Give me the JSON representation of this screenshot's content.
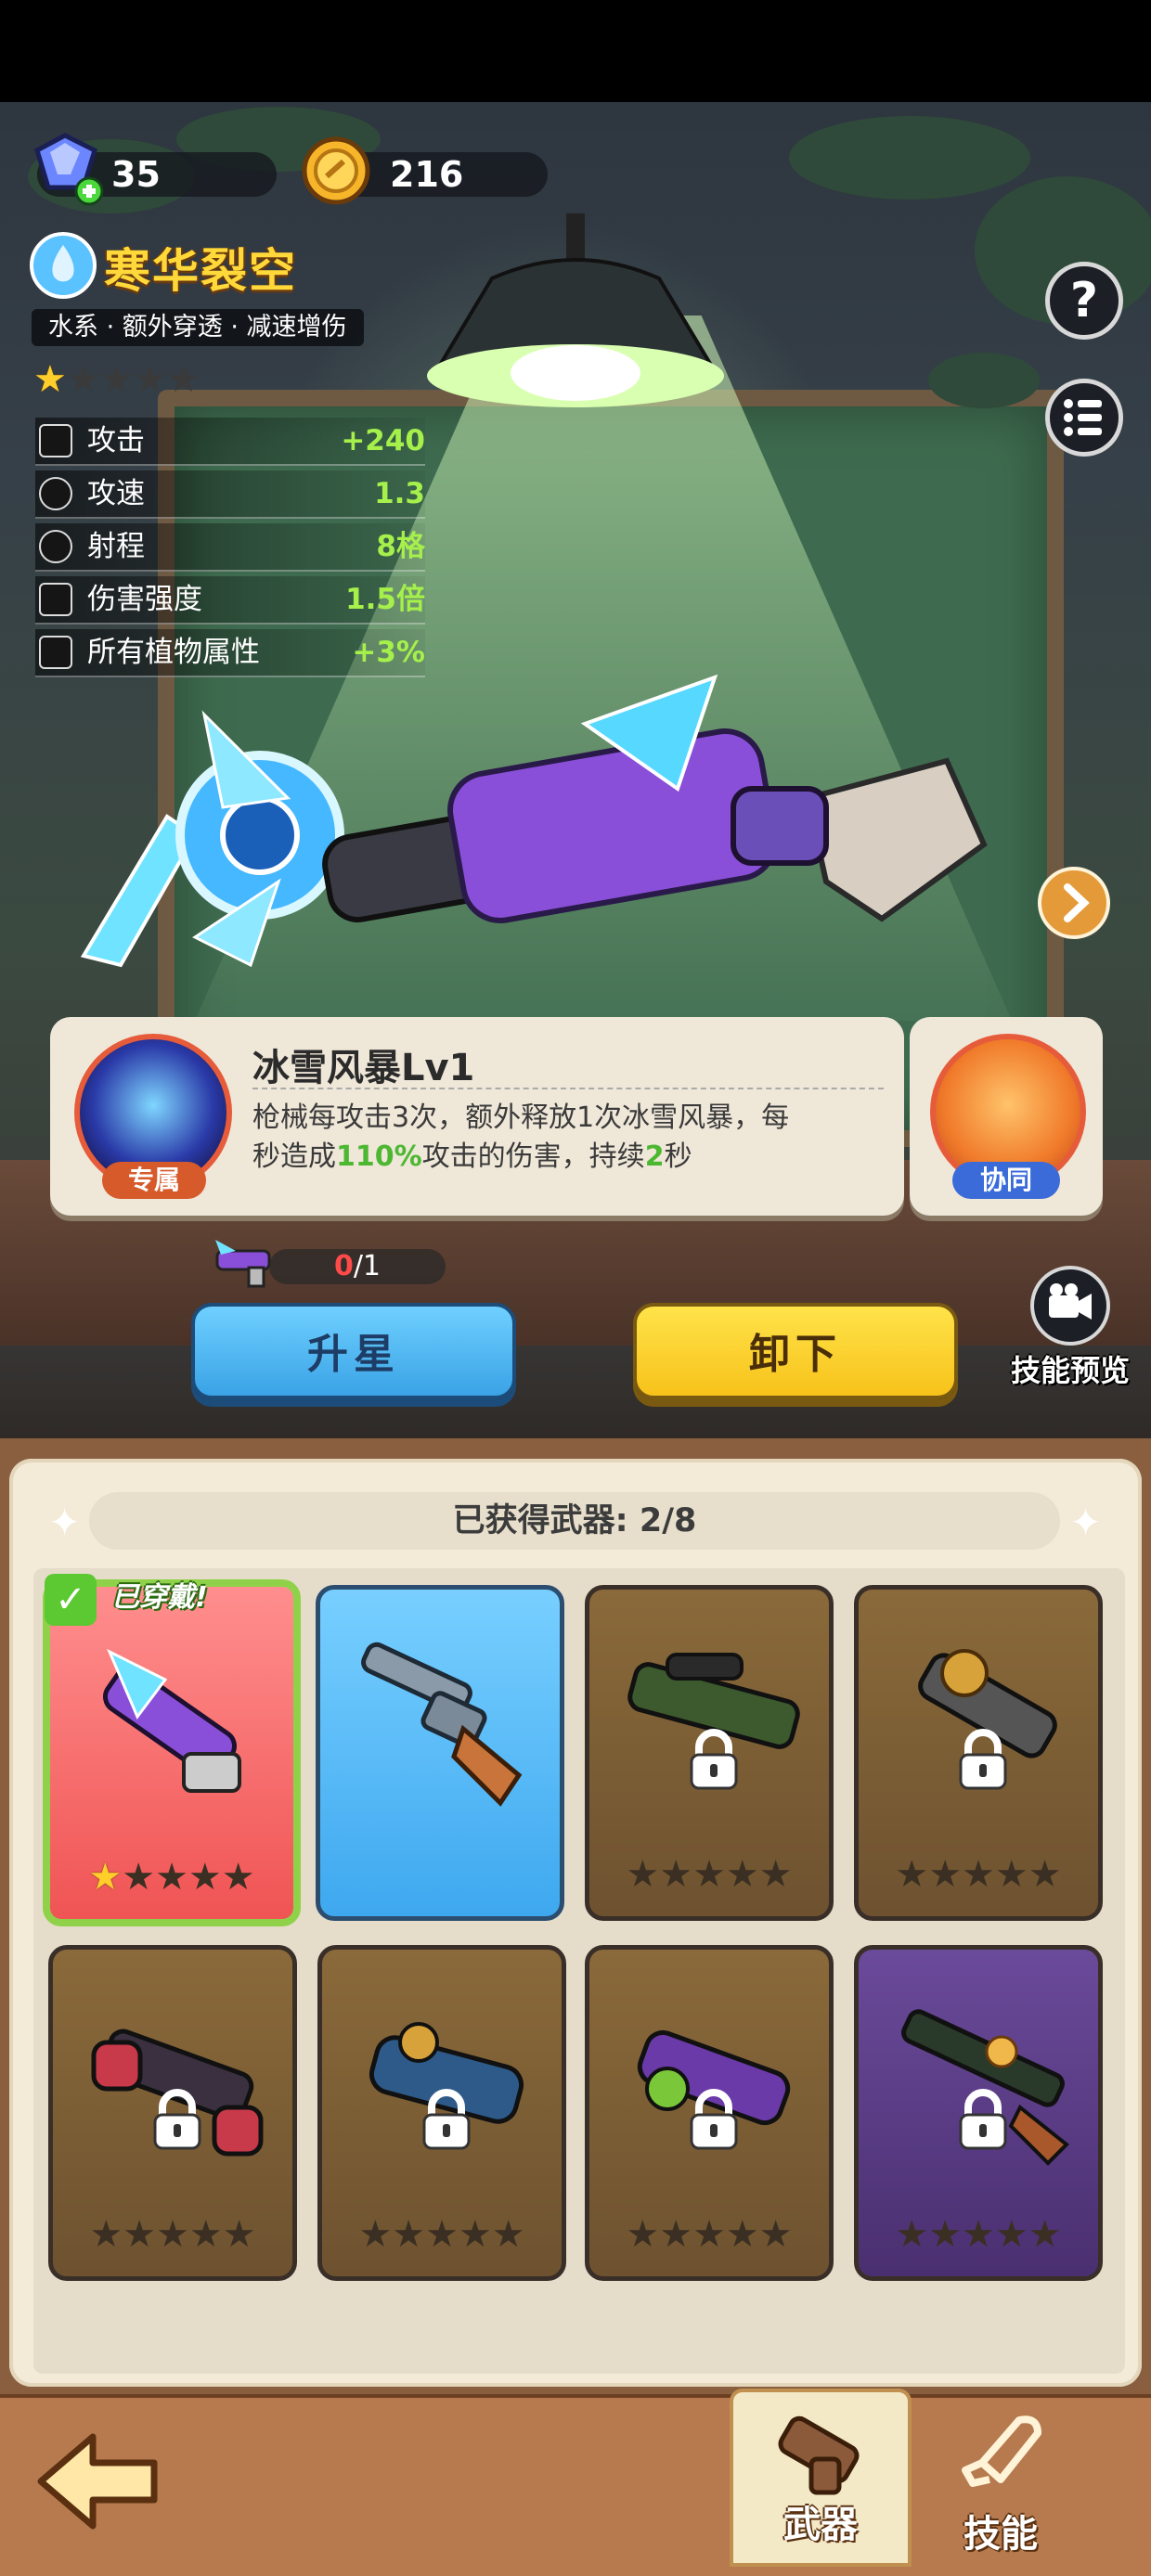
{
  "currency": {
    "gems": "35",
    "coins": "216"
  },
  "weapon": {
    "name": "寒华裂空",
    "tags": "水系 · 额外穿透 · 减速增伤",
    "stars_filled": 1,
    "stars_total": 5,
    "stats": [
      {
        "icon": "attack-icon",
        "label": "攻击",
        "value": "+240"
      },
      {
        "icon": "attack-speed-icon",
        "label": "攻速",
        "value": "1.3"
      },
      {
        "icon": "range-icon",
        "label": "射程",
        "value": "8格"
      },
      {
        "icon": "damage-strength-icon",
        "label": "伤害强度",
        "value": "1.5倍"
      },
      {
        "icon": "plant-attribute-icon",
        "label": "所有植物属性",
        "value": "+3%"
      }
    ]
  },
  "skill": {
    "badge": "专属",
    "title": "冰雪风暴Lv1",
    "desc_1": "枪械每攻击3次，额外释放1次冰雪风暴，每",
    "desc_2a": "秒造成",
    "desc_2b": "110%",
    "desc_2c": "攻击的伤害，持续",
    "desc_2d": "2",
    "desc_2e": "秒",
    "coop_label": "协同"
  },
  "upgrade": {
    "progress_current": "0",
    "progress_rest": "/1",
    "star_up_label": "升星",
    "unequip_label": "卸下",
    "preview_label": "技能预览"
  },
  "inventory": {
    "header": "已获得武器: 2/8",
    "equipped_badge": "已穿戴!",
    "weapons": [
      {
        "state": "equipped",
        "stars_filled": 1
      },
      {
        "state": "owned",
        "stars_filled": 0
      },
      {
        "state": "locked",
        "stars_filled": 0
      },
      {
        "state": "locked",
        "stars_filled": 0
      },
      {
        "state": "locked",
        "stars_filled": 0
      },
      {
        "state": "locked",
        "stars_filled": 0
      },
      {
        "state": "locked",
        "stars_filled": 0
      },
      {
        "state": "locked",
        "stars_filled": 0
      }
    ]
  },
  "nav": {
    "weapons_label": "武器",
    "skills_label": "技能"
  },
  "colors": {
    "gold_title": "#ffd93a",
    "stat_value": "#a6f04c",
    "star_button": "#3aa3e6",
    "unequip_button": "#f7c21a",
    "equipped_border": "#8fd24a",
    "progress_red": "#ff4a4a"
  }
}
